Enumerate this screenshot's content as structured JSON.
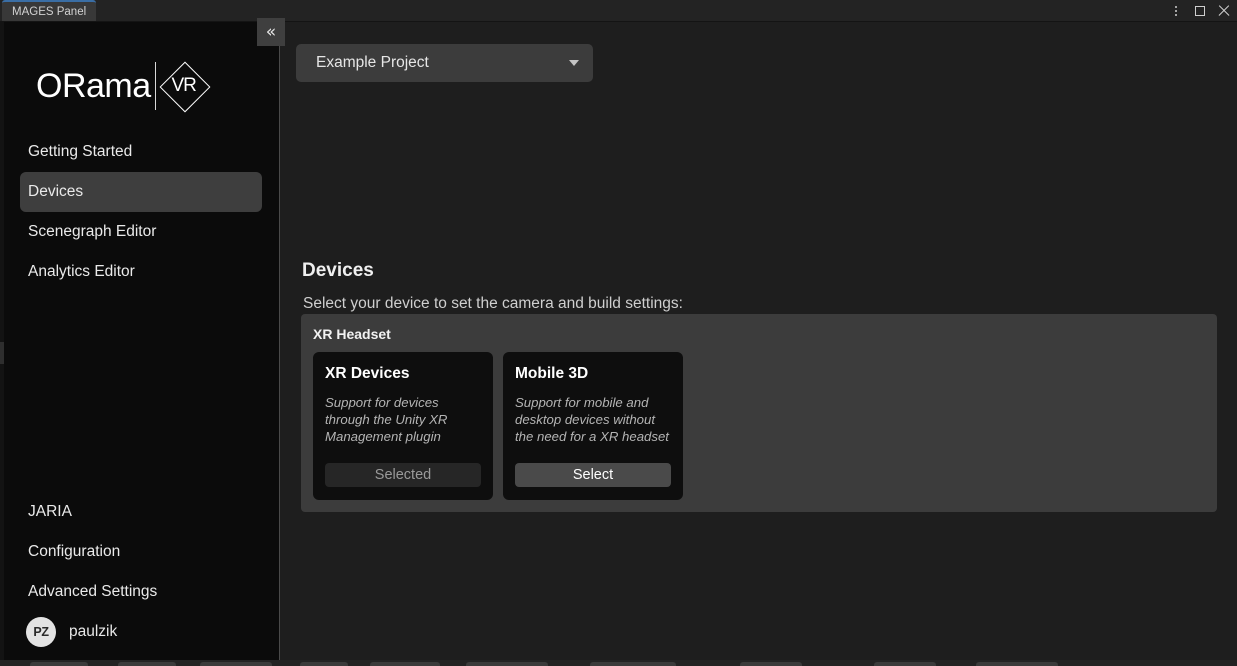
{
  "window": {
    "tab_label": "MAGES Panel",
    "controls": [
      {
        "name": "kebab-menu",
        "glyph": "⋮"
      },
      {
        "name": "maximize",
        "glyph": "▢"
      },
      {
        "name": "close",
        "glyph": "✕"
      }
    ],
    "accent_color": "#3a6ea5",
    "titlebar_bg": "#232323"
  },
  "sidebar": {
    "bg": "#0b0b0b",
    "collapse_button": {
      "label": "«",
      "tooltip": "Collapse"
    },
    "logo": {
      "word": "ORama",
      "badge": "VR"
    },
    "items": [
      {
        "label": "Getting Started",
        "active": false
      },
      {
        "label": "Devices",
        "active": true
      },
      {
        "label": "Scenegraph Editor",
        "active": false
      },
      {
        "label": "Analytics Editor",
        "active": false
      }
    ],
    "bottom_items": [
      {
        "label": "JARIA"
      },
      {
        "label": "Configuration"
      },
      {
        "label": "Advanced Settings"
      }
    ],
    "user": {
      "initials": "PZ",
      "name": "paulzik"
    },
    "active_highlight_color": "#3e3e3e"
  },
  "main": {
    "bg": "#1e1e1e",
    "project_selector": {
      "value": "Example Project",
      "placeholder": "Select project"
    },
    "page_title": "Devices",
    "page_subtitle": "Select your device to set the camera and build settings:",
    "group": {
      "title": "XR Headset",
      "bg": "#3c3c3c",
      "cards": [
        {
          "title": "XR Devices",
          "description": "Support for devices through the Unity XR Management plugin",
          "button_label": "Selected",
          "state": "selected"
        },
        {
          "title": "Mobile 3D",
          "description": "Support for mobile and desktop devices without the need for a XR headset",
          "button_label": "Select",
          "state": "unselected"
        }
      ]
    }
  }
}
